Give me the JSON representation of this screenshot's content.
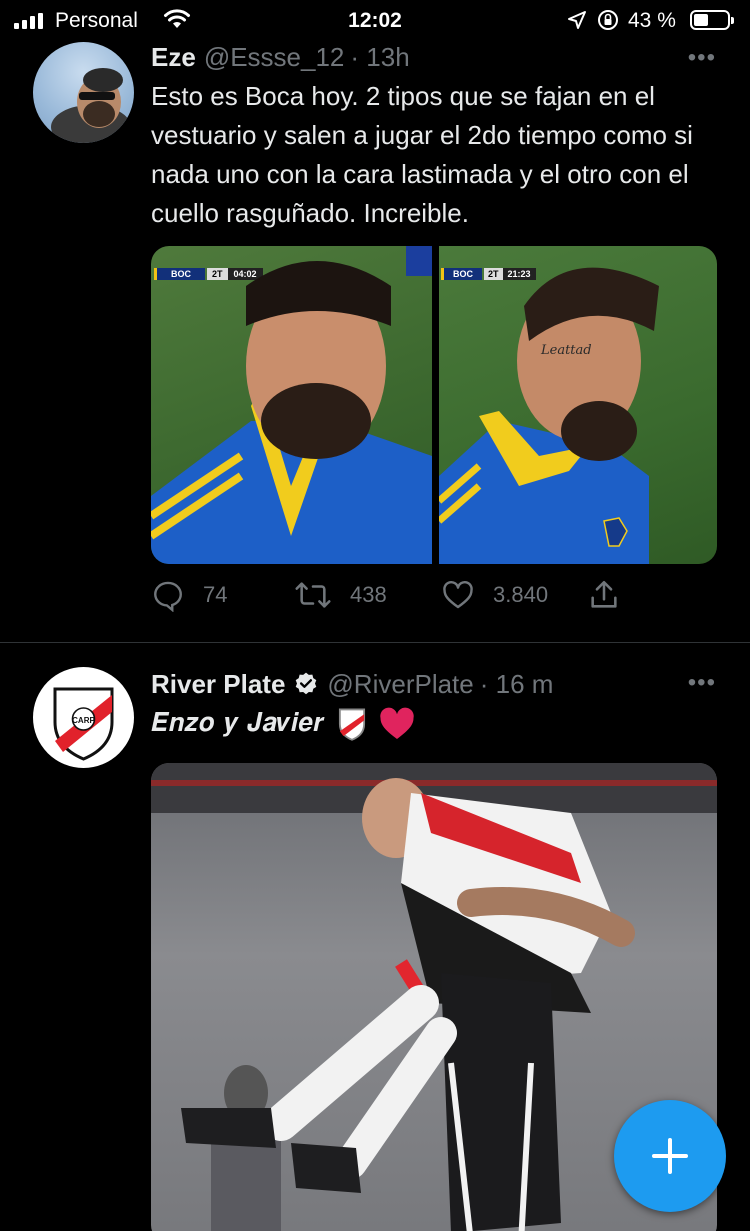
{
  "status_bar": {
    "carrier": "Personal",
    "time": "12:02",
    "battery_percent": "43 %",
    "battery_level": 0.43
  },
  "tweets": [
    {
      "name": "Eze",
      "handle": "@Essse_12",
      "time": "· 13h",
      "text": "Esto es Boca hoy. 2 tipos que se fajan en el vestuario y salen a jugar el 2do tiempo como si nada uno con la cara lastimada y el otro con el cuello rasguñado. Increible.",
      "media_left_scoreboard": {
        "team": "BOC",
        "period": "2T",
        "clock": "04:02"
      },
      "media_right_scoreboard": {
        "team": "BOC",
        "period": "2T",
        "clock": "21:23"
      },
      "replies": "74",
      "retweets": "438",
      "likes": "3.840"
    },
    {
      "name": "River Plate",
      "handle": "@RiverPlate",
      "time": "· 16 m",
      "text": "𝑬𝒏𝒛𝒐 𝒚 𝑱𝒂𝒗𝒊𝒆𝒓",
      "logo_text": "CARP"
    }
  ],
  "fab": {
    "label": "+"
  },
  "colors": {
    "accent": "#1d9bf0",
    "background": "#000000",
    "secondary_text": "#71767b",
    "divider": "#2f3336",
    "heart": "#e0245e"
  },
  "icons": [
    "signal-icon",
    "wifi-icon",
    "location-icon",
    "rotation-lock-icon",
    "battery-icon",
    "more-icon",
    "reply-icon",
    "retweet-icon",
    "like-icon",
    "share-icon",
    "verified-icon",
    "river-shield-icon",
    "heart-emoji-icon",
    "compose-icon"
  ]
}
